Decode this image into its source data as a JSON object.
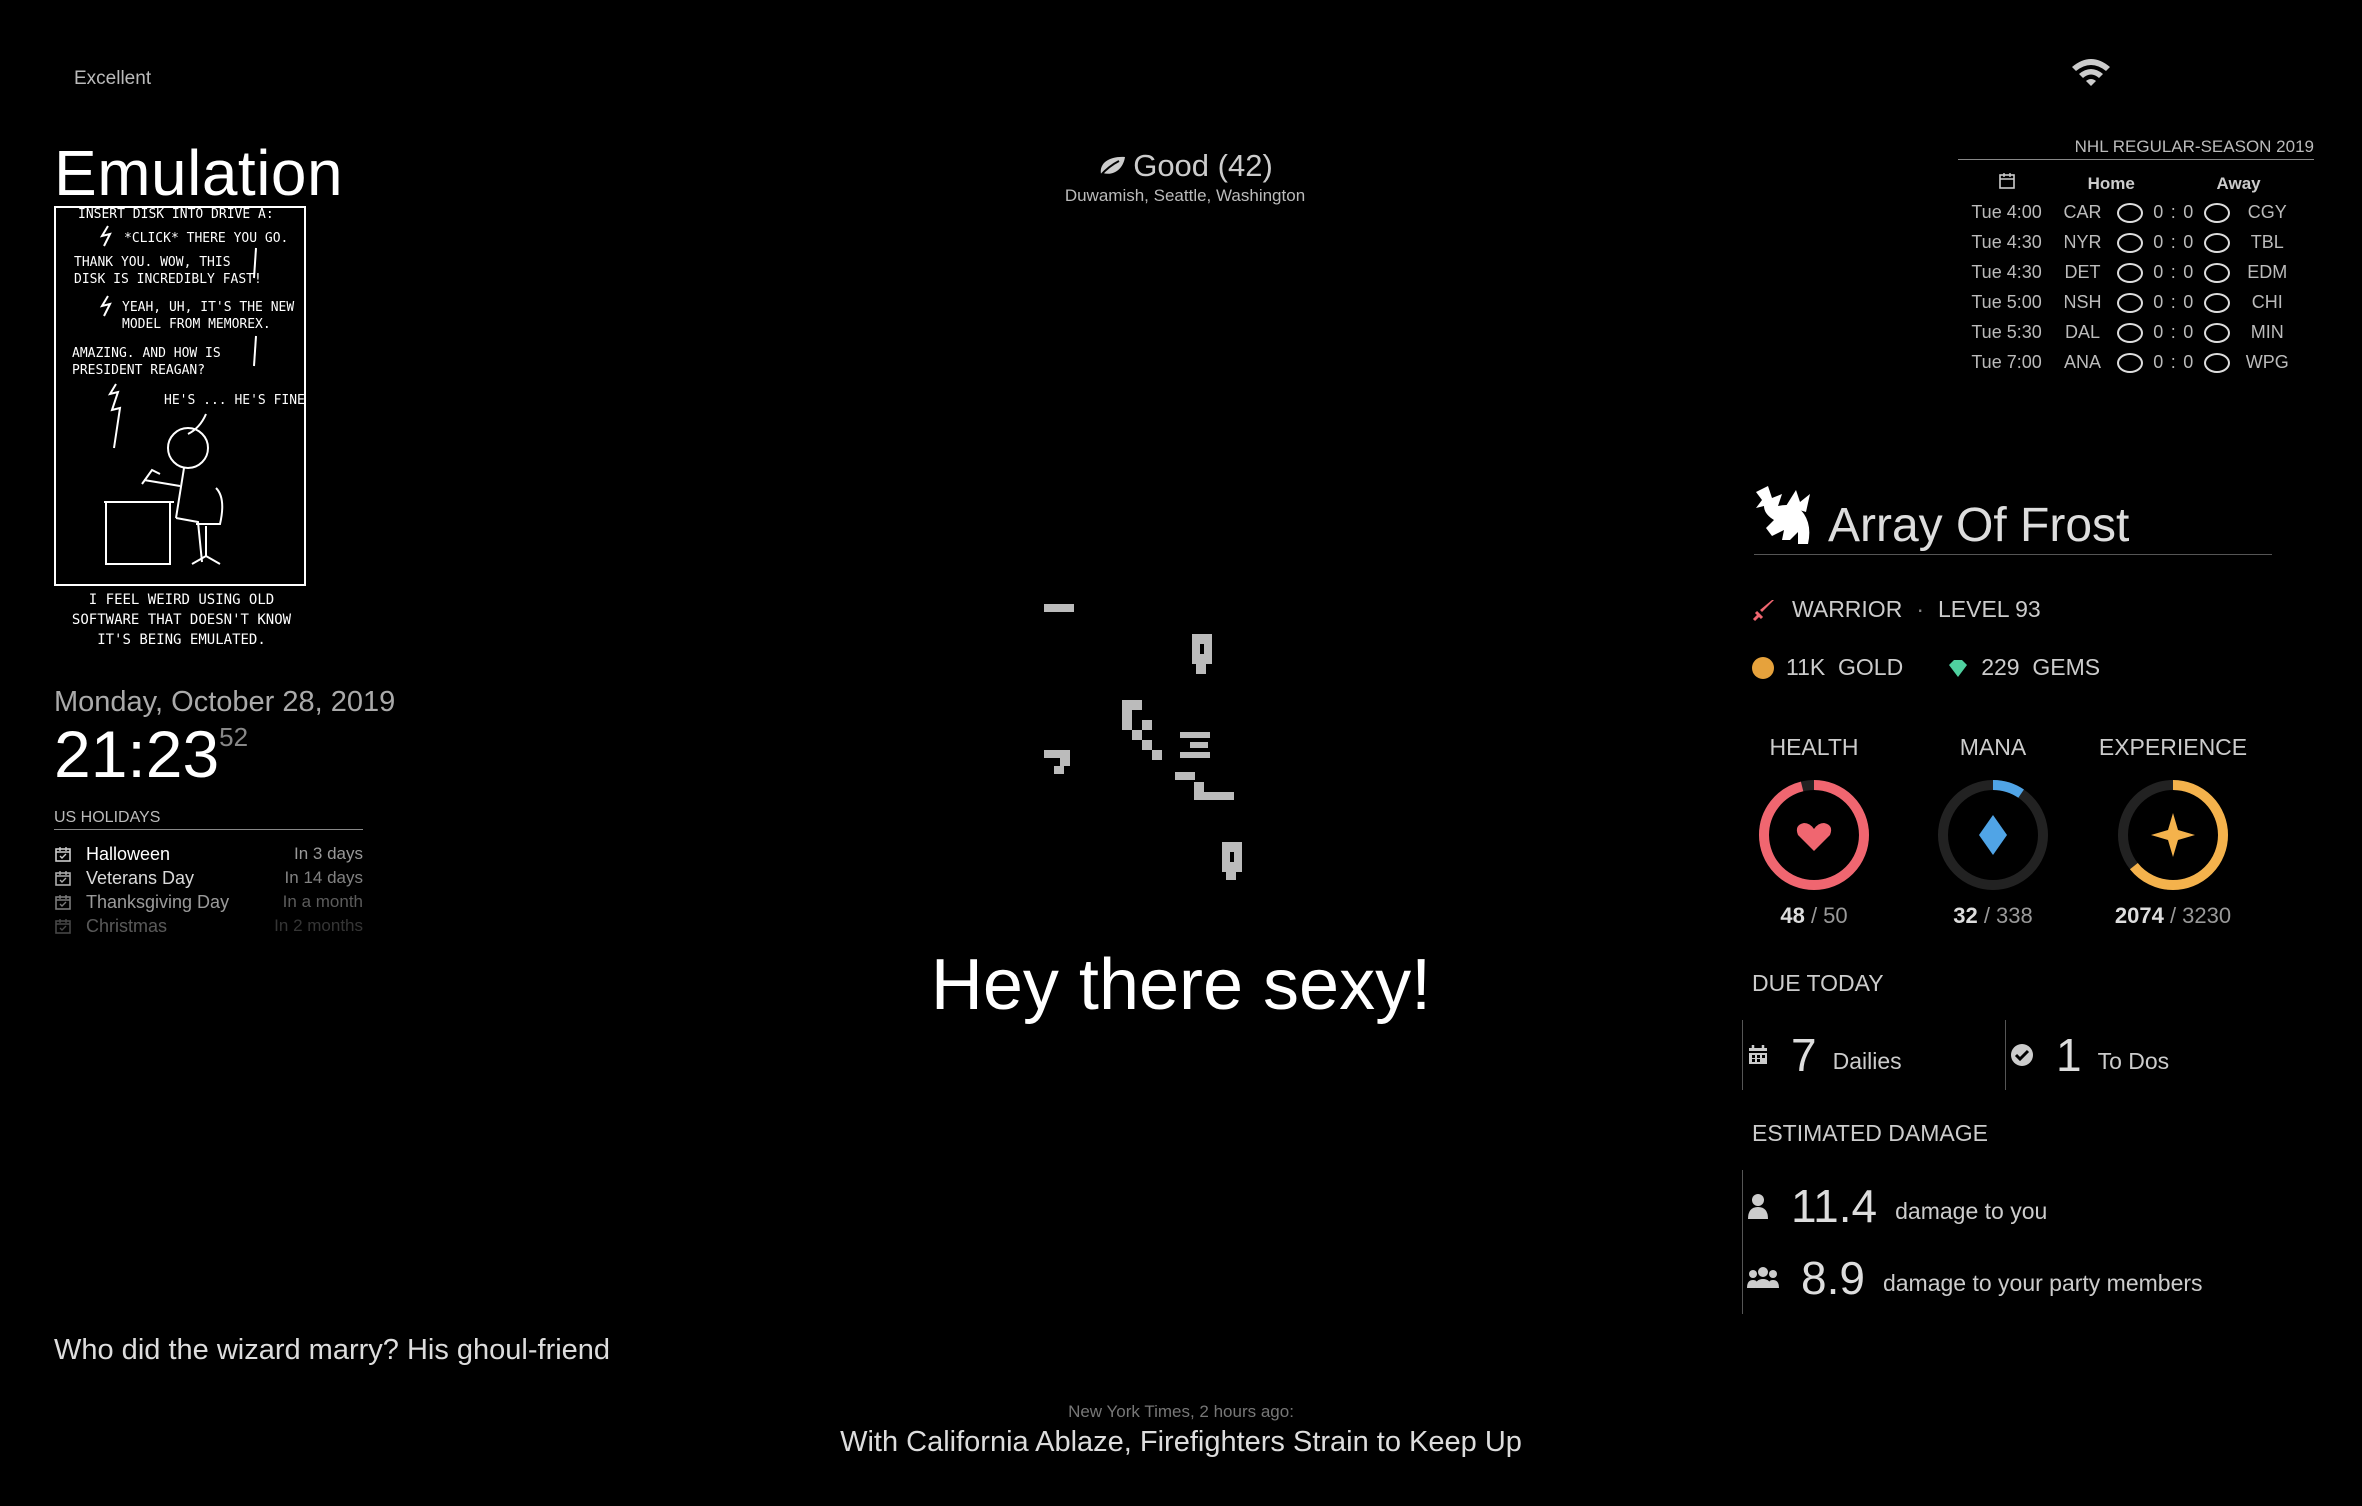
{
  "compliments_signal": "Excellent",
  "xkcd": {
    "title": "Emulation",
    "panel_lines": [
      "INSERT DISK INTO DRIVE A:",
      "*CLICK* THERE YOU GO.",
      "THANK YOU. WOW, THIS",
      "DISK IS INCREDIBLY FAST!",
      "YEAH, UH, IT'S THE NEW",
      "MODEL FROM MEMOREX.",
      "AMAZING. AND HOW IS",
      "PRESIDENT REAGAN?",
      "HE'S ... HE'S FINE."
    ],
    "caption": "I FEEL WEIRD USING OLD SOFTWARE THAT DOESN'T KNOW IT'S BEING EMULATED."
  },
  "clock": {
    "date": "Monday, October 28, 2019",
    "time": "21:23",
    "seconds": "52"
  },
  "calendar": {
    "header": "US HOLIDAYS",
    "events": [
      {
        "name": "Halloween",
        "when": "In 3 days",
        "opacity": 1.0
      },
      {
        "name": "Veterans Day",
        "when": "In 14 days",
        "opacity": 0.85
      },
      {
        "name": "Thanksgiving Day",
        "when": "In a month",
        "opacity": 0.6
      },
      {
        "name": "Christmas",
        "when": "In 2 months",
        "opacity": 0.35
      }
    ]
  },
  "air_quality": {
    "label": "Good (42)",
    "location": "Duwamish, Seattle, Washington"
  },
  "greeting": "Hey there sexy!",
  "joke": "Who did the wizard marry? His ghoul-friend",
  "news": {
    "source": "New York Times, 2 hours ago:",
    "headline": "With California Ablaze, Firefighters Strain to Keep Up"
  },
  "nhl": {
    "title": "NHL REGULAR-SEASON 2019",
    "home_header": "Home",
    "away_header": "Away",
    "games": [
      {
        "time": "Tue 4:00",
        "home": "CAR",
        "home_score": "0",
        "sep": ":",
        "away_score": "0",
        "away": "CGY"
      },
      {
        "time": "Tue 4:30",
        "home": "NYR",
        "home_score": "0",
        "sep": ":",
        "away_score": "0",
        "away": "TBL"
      },
      {
        "time": "Tue 4:30",
        "home": "DET",
        "home_score": "0",
        "sep": ":",
        "away_score": "0",
        "away": "EDM"
      },
      {
        "time": "Tue 5:00",
        "home": "NSH",
        "home_score": "0",
        "sep": ":",
        "away_score": "0",
        "away": "CHI"
      },
      {
        "time": "Tue 5:30",
        "home": "DAL",
        "home_score": "0",
        "sep": ":",
        "away_score": "0",
        "away": "MIN"
      },
      {
        "time": "Tue 7:00",
        "home": "ANA",
        "home_score": "0",
        "sep": ":",
        "away_score": "0",
        "away": "WPG"
      }
    ]
  },
  "habitica": {
    "name": "Array Of Frost",
    "class": "WARRIOR",
    "level": "LEVEL 93",
    "gold": "11K",
    "gold_label": "GOLD",
    "gems": "229",
    "gems_label": "GEMS",
    "health": {
      "label": "HEALTH",
      "current": "48",
      "max": "50",
      "fraction": 0.96,
      "color": "#f06670"
    },
    "mana": {
      "label": "MANA",
      "current": "32",
      "max": "338",
      "fraction": 0.095,
      "color": "#50a4e6"
    },
    "experience": {
      "label": "EXPERIENCE",
      "current": "2074",
      "max": "3230",
      "fraction": 0.642,
      "color": "#f4b24c"
    },
    "due_title": "DUE TODAY",
    "dailies_count": "7",
    "dailies_label": "Dailies",
    "todos_count": "1",
    "todos_label": "To Dos",
    "damage_title": "ESTIMATED DAMAGE",
    "damage_you": "11.4",
    "damage_you_label": "damage to you",
    "damage_party": "8.9",
    "damage_party_label": "damage to your party members"
  },
  "icons": {
    "wifi": "wifi-icon",
    "leaf": "leaf-icon",
    "calendar": "calendar-icon",
    "sword": "sword-icon",
    "coin": "coin-icon",
    "gem": "gem-icon",
    "check": "check-circle-icon",
    "user": "user-icon",
    "users": "users-icon"
  }
}
